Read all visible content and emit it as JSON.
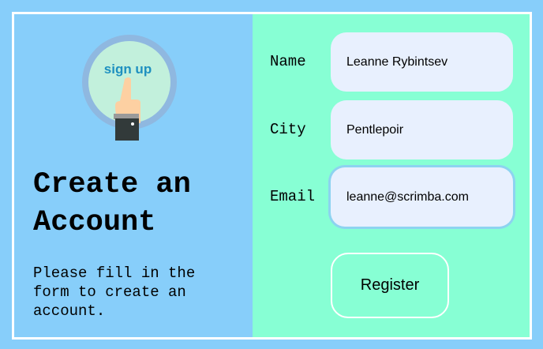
{
  "logo": {
    "text": "sign up",
    "icon": "hand-pointing-signup-icon"
  },
  "left": {
    "title": "Create an Account",
    "description": "Please fill in the form to create an account."
  },
  "form": {
    "fields": [
      {
        "label": "Name",
        "value": "Leanne Rybintsev"
      },
      {
        "label": "City",
        "value": "Pentlepoir"
      },
      {
        "label": "Email",
        "value": "leanne@scrimba.com"
      }
    ],
    "register_label": "Register"
  },
  "colors": {
    "background": "#87cefa",
    "form_panel": "#87ffd4",
    "input": "#e8f0fe"
  }
}
